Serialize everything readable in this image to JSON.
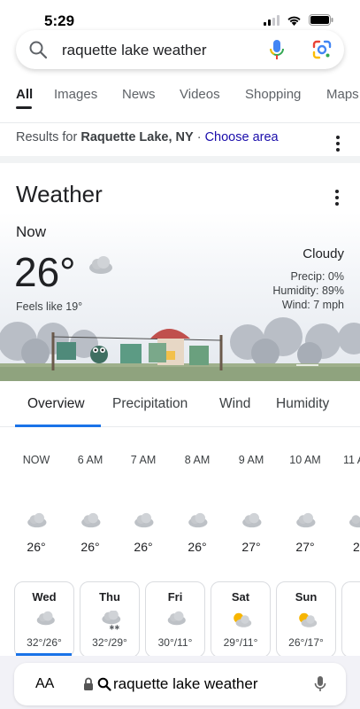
{
  "status": {
    "time": "5:29"
  },
  "search": {
    "query": "raquette lake weather"
  },
  "tabs": [
    {
      "label": "All"
    },
    {
      "label": "Images"
    },
    {
      "label": "News"
    },
    {
      "label": "Videos"
    },
    {
      "label": "Shopping"
    },
    {
      "label": "Maps"
    }
  ],
  "results_for": {
    "prefix": "Results for",
    "place": "Raquette Lake, NY",
    "separator": "·",
    "link": "Choose area"
  },
  "weather": {
    "title": "Weather",
    "now_label": "Now",
    "temperature": "26",
    "unit": "°",
    "feels_like": "Feels like 19°",
    "condition": "Cloudy",
    "precip": "Precip: 0%",
    "humidity": "Humidity: 89%",
    "wind": "Wind: 7 mph",
    "tabs": [
      {
        "label": "Overview"
      },
      {
        "label": "Precipitation"
      },
      {
        "label": "Wind"
      },
      {
        "label": "Humidity"
      }
    ],
    "hourly": [
      {
        "time": "NOW",
        "icon": "cloud-icon",
        "temp": "26°"
      },
      {
        "time": "6 AM",
        "icon": "cloud-icon",
        "temp": "26°"
      },
      {
        "time": "7 AM",
        "icon": "cloud-icon",
        "temp": "26°"
      },
      {
        "time": "8 AM",
        "icon": "cloud-icon",
        "temp": "26°"
      },
      {
        "time": "9 AM",
        "icon": "cloud-icon",
        "temp": "27°"
      },
      {
        "time": "10 AM",
        "icon": "cloud-icon",
        "temp": "27°"
      },
      {
        "time": "11 A",
        "icon": "cloud-icon",
        "temp": "2"
      }
    ],
    "daily": [
      {
        "day": "Wed",
        "icon": "cloud-icon",
        "range": "32°/26°"
      },
      {
        "day": "Thu",
        "icon": "snow-cloud-icon",
        "range": "32°/29°"
      },
      {
        "day": "Fri",
        "icon": "cloud-icon",
        "range": "30°/11°"
      },
      {
        "day": "Sat",
        "icon": "partly-sunny-icon",
        "range": "29°/11°"
      },
      {
        "day": "Sun",
        "icon": "partly-sunny-icon",
        "range": "26°/17°"
      }
    ]
  },
  "browser": {
    "aa_label": "AA",
    "url_text": "raquette lake weather"
  },
  "colors": {
    "accent": "#1a73e8",
    "link": "#1a0dab"
  }
}
